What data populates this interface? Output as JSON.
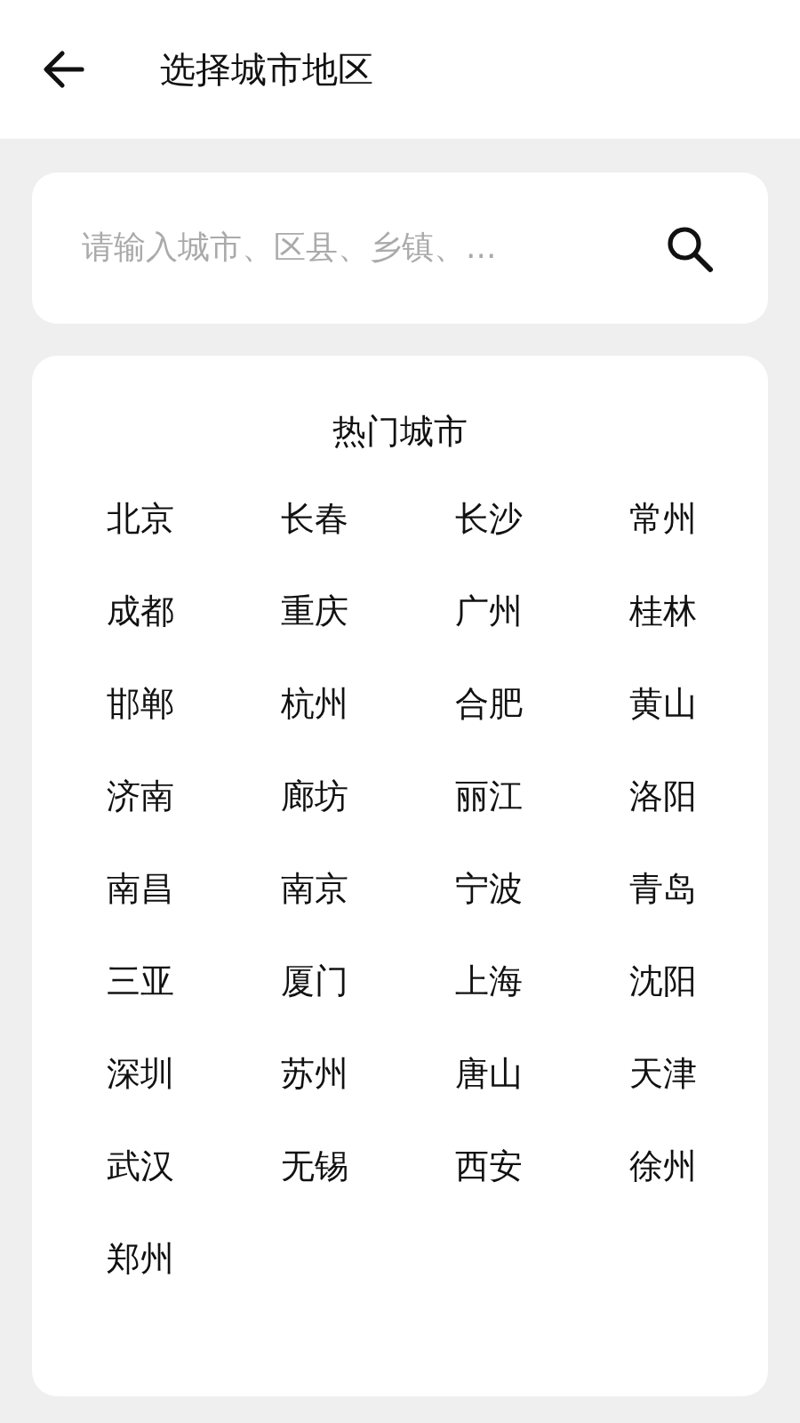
{
  "header": {
    "title": "选择城市地区"
  },
  "search": {
    "placeholder": "请输入城市、区县、乡镇、..."
  },
  "hot_cities": {
    "title": "热门城市",
    "items": [
      "北京",
      "长春",
      "长沙",
      "常州",
      "成都",
      "重庆",
      "广州",
      "桂林",
      "邯郸",
      "杭州",
      "合肥",
      "黄山",
      "济南",
      "廊坊",
      "丽江",
      "洛阳",
      "南昌",
      "南京",
      "宁波",
      "青岛",
      "三亚",
      "厦门",
      "上海",
      "沈阳",
      "深圳",
      "苏州",
      "唐山",
      "天津",
      "武汉",
      "无锡",
      "西安",
      "徐州",
      "郑州"
    ]
  }
}
